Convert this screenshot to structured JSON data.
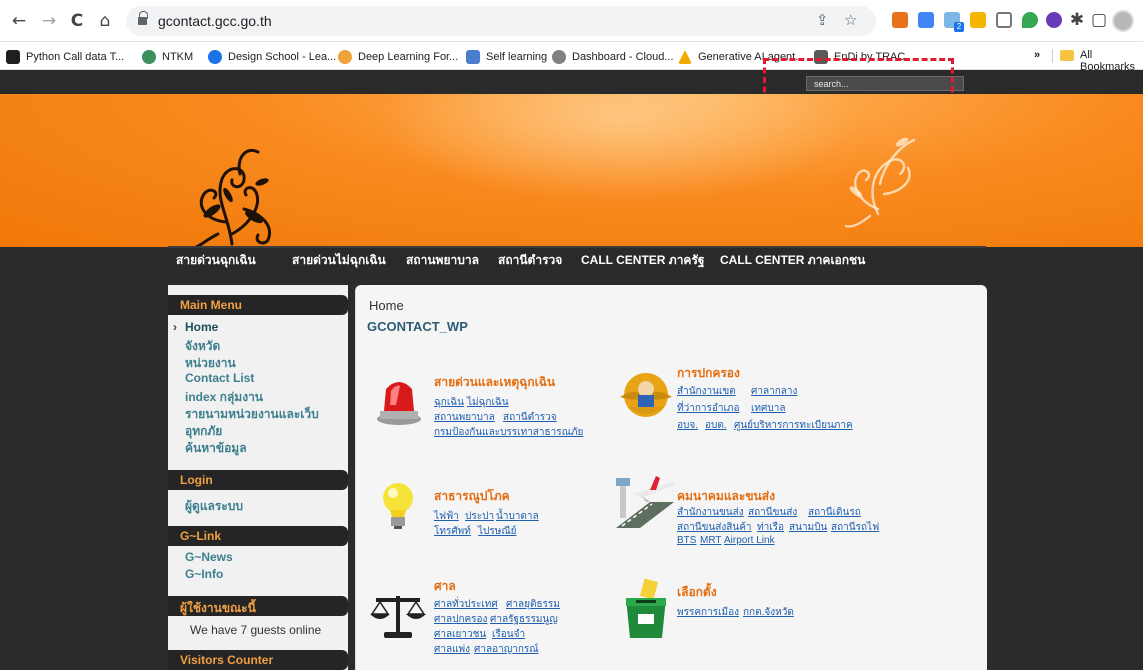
{
  "browser": {
    "back_glyph": "←",
    "forward_glyph": "→",
    "reload_glyph": "C",
    "home_glyph": "⌂",
    "url": "gcontact.gcc.go.th",
    "share_glyph": "⇪",
    "star_glyph": "☆",
    "puzzle_glyph": "✱",
    "sidepanel_glyph": "▢",
    "extension_badge": "2"
  },
  "bookmarks": {
    "items": [
      {
        "label": "Python Call data T...",
        "icon": "python-data-icon",
        "color": "#1f1f1f"
      },
      {
        "label": "NTKM",
        "icon": "ntkm-icon",
        "color": "#3a8f5a"
      },
      {
        "label": "Design School - Lea...",
        "icon": "design-school-icon",
        "color": "#1a73e8"
      },
      {
        "label": "Deep Learning For...",
        "icon": "deep-learning-icon",
        "color": "#f0a33a"
      },
      {
        "label": "Self learning",
        "icon": "self-learning-icon",
        "color": "#4a7fd0"
      },
      {
        "label": "Dashboard - Cloud...",
        "icon": "cloud-dashboard-icon",
        "color": "#808080"
      },
      {
        "label": "Generative AI agent...",
        "icon": "generative-ai-icon",
        "color": "#f2a900"
      },
      {
        "label": "EnDi by TRAC",
        "icon": "endi-icon",
        "color": "#5a5a5a"
      }
    ],
    "more_glyph": "»",
    "all_bookmarks": "All Bookmarks"
  },
  "site": {
    "search_placeholder": "search...",
    "accent": "#f07808",
    "nav": [
      "สายด่วนฉุกเฉิน",
      "สายด่วนไม่ฉุกเฉิน",
      "สถานพยาบาล",
      "สถานีตำรวจ",
      "CALL CENTER ภาครัฐ",
      "CALL CENTER ภาคเอกชน"
    ]
  },
  "sidebar": {
    "main_menu_title": "Main Menu",
    "arrow": "›",
    "main_menu": [
      "Home",
      "จังหวัด",
      "หน่วยงาน",
      "Contact List",
      "index กลุ่มงาน",
      "รายนามหน่วยงานและเว็บ",
      "อุทกภัย",
      "ค้นหาข้อมูล"
    ],
    "login_title": "Login",
    "login_items": [
      "ผู้ดูแลระบบ"
    ],
    "glink_title": "G~Link",
    "glink_items": [
      "G~News",
      "G~Info"
    ],
    "online_title": "ผู้ใช้งานขณะนี้",
    "online_text": "We have 7 guests online",
    "visitors_title": "Visitors Counter"
  },
  "main": {
    "breadcrumb": "Home",
    "title": "GCONTACT_WP",
    "categories": {
      "emergency": {
        "title": "สายด่วนและเหตุฉุกเฉิน",
        "lines": [
          [
            "ฉุกเฉิน",
            "ไม่ฉุกเฉิน"
          ],
          [
            "สถานพยาบาล",
            "สถานีตำรวจ"
          ],
          [
            "กรมป้องกันและบรรเทาสาธารณภัย"
          ]
        ]
      },
      "government": {
        "title": "การปกครอง",
        "lines": [
          [
            "สำนักงานเขต",
            "ศาลากลาง"
          ],
          [
            "ที่ว่าการอำเภอ",
            "เทศบาล"
          ],
          [
            "อบจ.",
            "อบต.",
            "ศูนย์บริหารการทะเบียนภาค"
          ]
        ]
      },
      "utilities": {
        "title": "สาธารณูปโภค",
        "lines": [
          [
            "ไฟฟ้า",
            "ประปา",
            "น้ำบาดาล"
          ],
          [
            "โทรศัพท์",
            "ไปรษณีย์"
          ]
        ]
      },
      "transport": {
        "title": "คมนาคมและขนส่ง",
        "lines": [
          [
            "สำนักงานขนส่ง",
            "สถานีขนส่ง",
            "สถานีเดินรถ"
          ],
          [
            "สถานีขนส่งสินค้า",
            "ท่าเรือ",
            "สนามบิน",
            "สถานีรถไฟ"
          ],
          [
            "BTS",
            "MRT",
            "Airport Link"
          ]
        ]
      },
      "courts": {
        "title": "ศาล",
        "lines": [
          [
            "ศาลทั่วประเทศ",
            "ศาลยุติธรรม"
          ],
          [
            "ศาลปกครอง",
            "ศาลรัฐธรรมนูญ"
          ],
          [
            "ศาลเยาวชน",
            "เรือนจำ"
          ],
          [
            "ศาลแพ่ง",
            "ศาลอาญากรณ์"
          ]
        ]
      },
      "election": {
        "title": "เลือกตั้ง",
        "lines": [
          [
            "พรรคการเมือง",
            "กกต.จังหวัด"
          ]
        ]
      }
    }
  }
}
